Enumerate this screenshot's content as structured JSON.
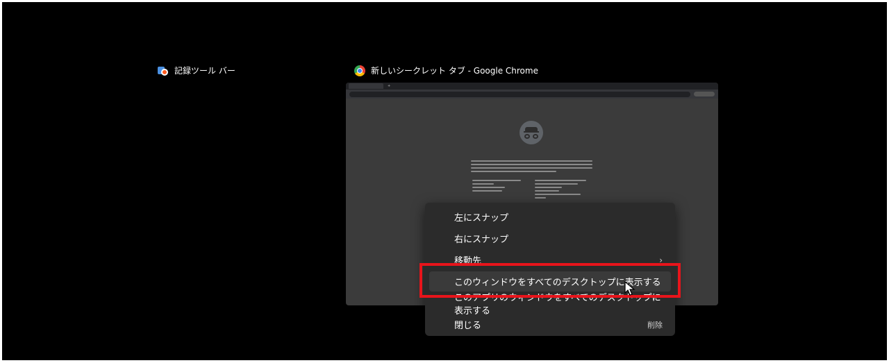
{
  "windows": [
    {
      "id": "recorder",
      "title": "記録ツール バー",
      "icon": "recorder-icon"
    },
    {
      "id": "chrome",
      "title": "新しいシークレット タブ - Google Chrome",
      "icon": "chrome-icon"
    }
  ],
  "context_menu": {
    "items": [
      {
        "label": "左にスナップ"
      },
      {
        "label": "右にスナップ"
      },
      {
        "label": "移動先",
        "submenu_icon": "chevron-right-icon"
      },
      {
        "label": "このウィンドウをすべてのデスクトップに表示する",
        "highlighted": true
      },
      {
        "label": "このアプリのウィンドウをすべてのデスクトップに表示する"
      },
      {
        "label": "閉じる",
        "shortcut": "削除"
      }
    ]
  },
  "colors": {
    "background": "#000000",
    "menu_background": "#2b2b2b",
    "menu_highlight": "#3a3a3a",
    "annotation_box": "#e8141b",
    "text": "#ffffff"
  }
}
